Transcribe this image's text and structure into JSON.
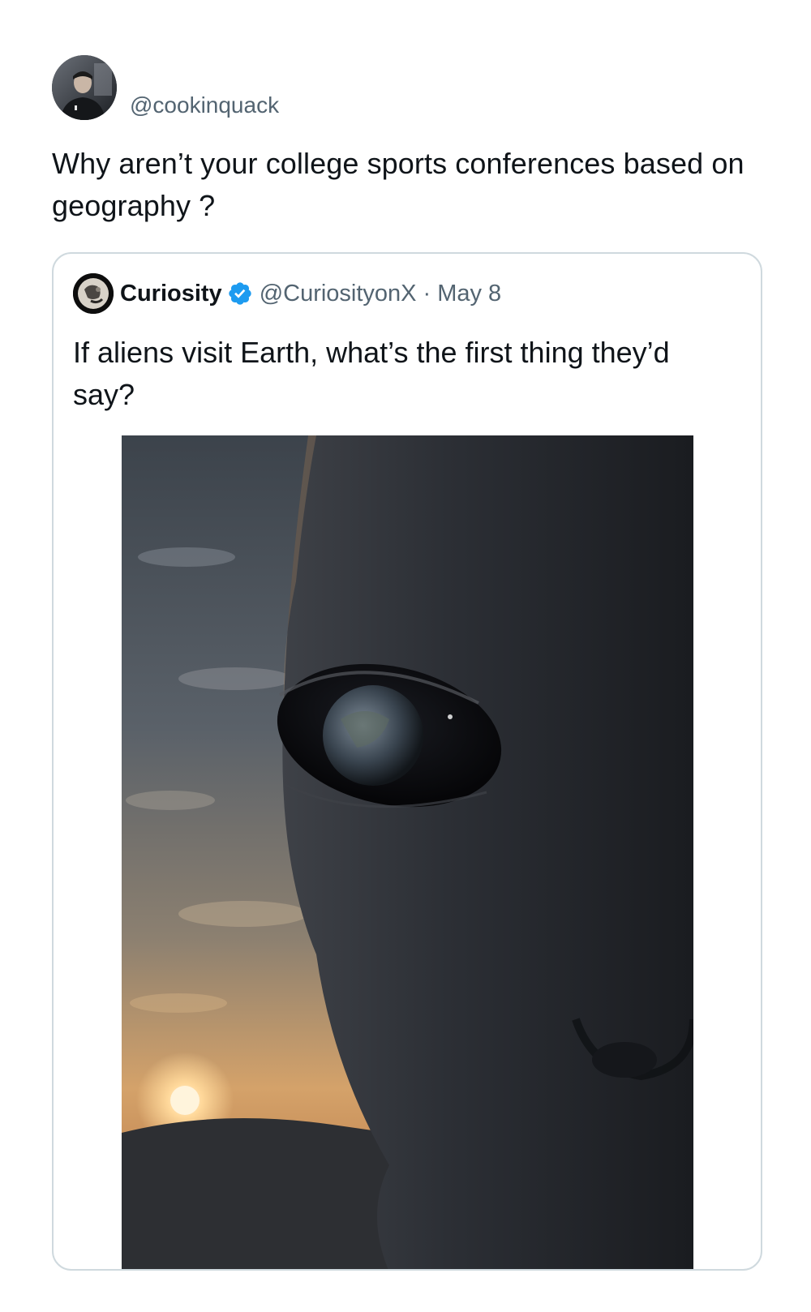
{
  "tweet": {
    "handle": "@cookinquack",
    "avatar_icon": "profile-photo",
    "text": "Why aren’t your college sports conferences based on geography ?"
  },
  "quote": {
    "name": "Curiosity",
    "verified_icon": "verified-badge-icon",
    "handle": "@CuriosityonX",
    "separator": "·",
    "date": "May 8",
    "text": "If aliens visit Earth, what’s the first thing they’d say?",
    "media_icon": "alien-eye-photo"
  },
  "colors": {
    "text": "#0f1419",
    "secondary": "#536471",
    "border": "#cfd9de",
    "verified": "#1d9bf0"
  }
}
